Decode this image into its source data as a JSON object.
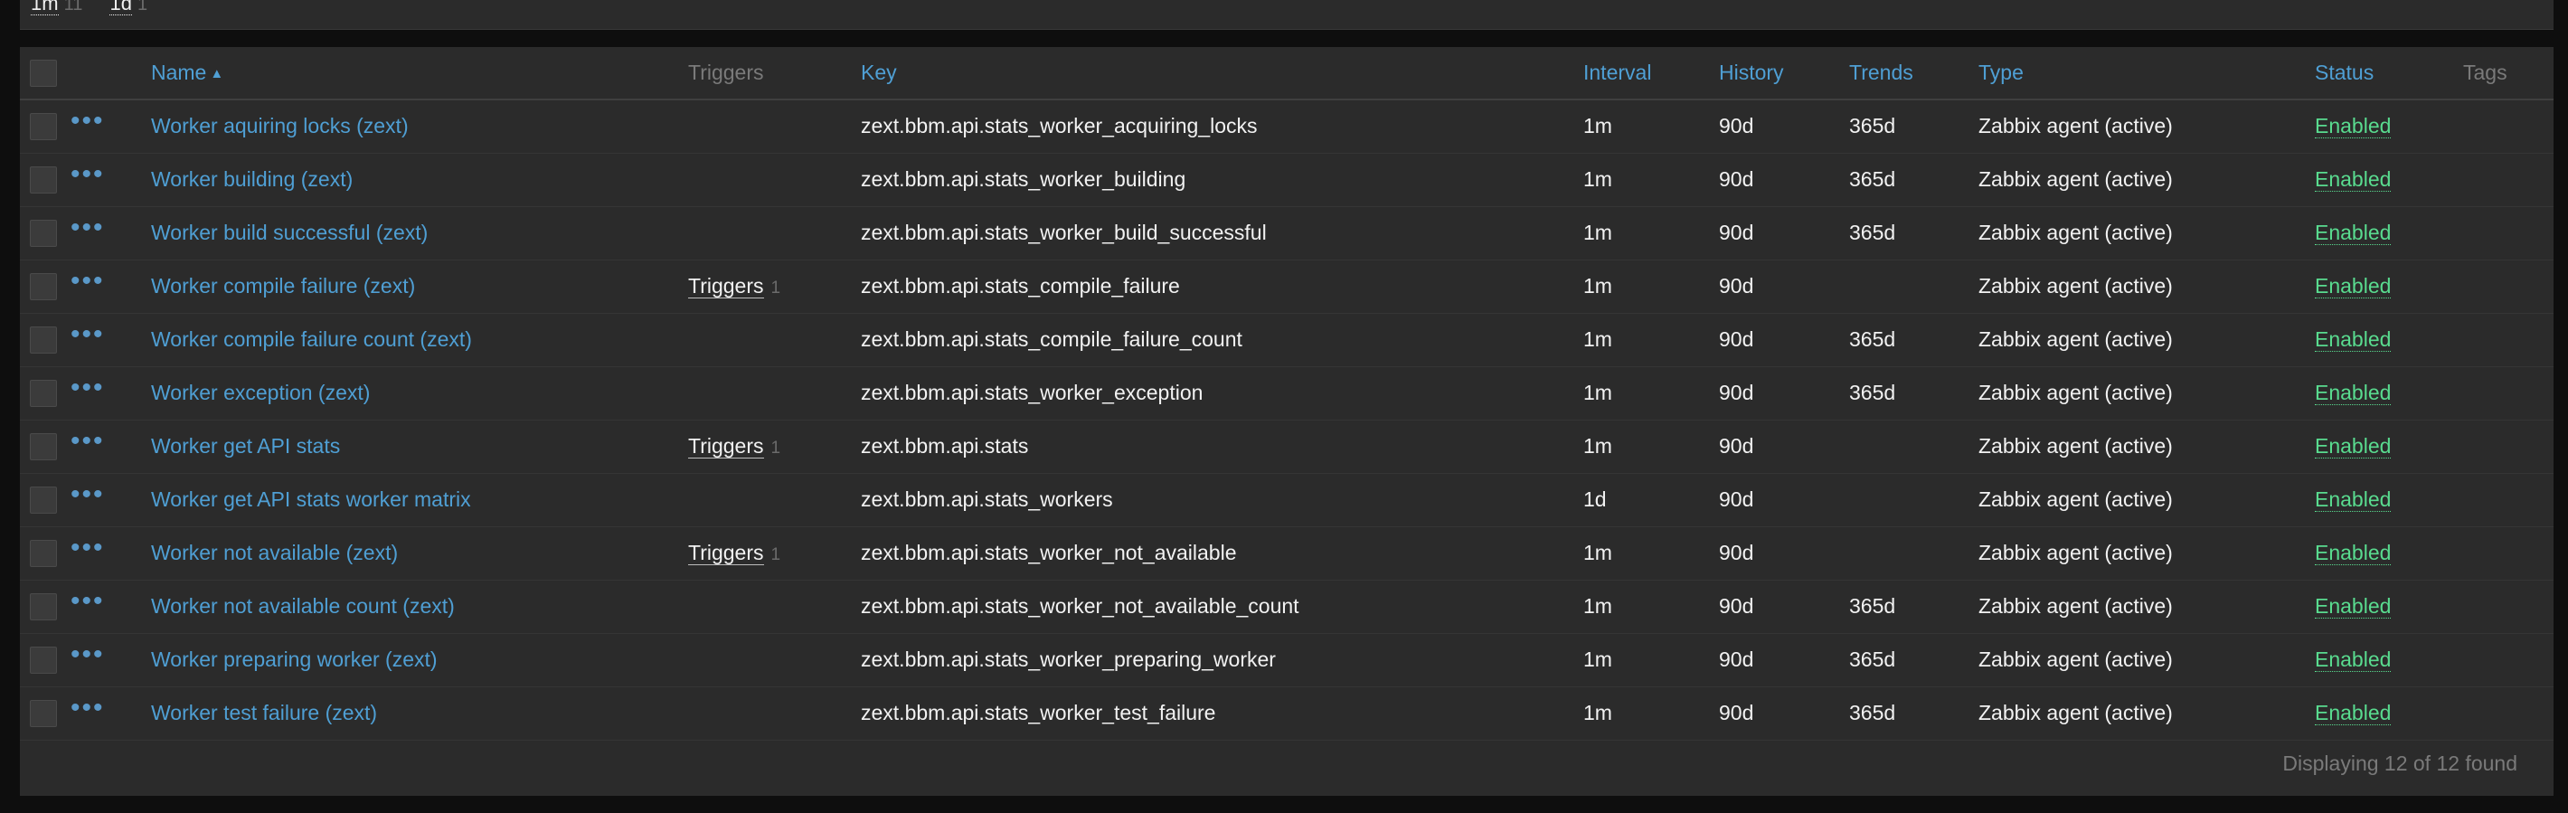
{
  "filter": {
    "tags": [
      {
        "label": "1m",
        "count": "11"
      },
      {
        "label": "1d",
        "count": "1"
      }
    ]
  },
  "table": {
    "headers": {
      "name": "Name",
      "name_sort_icon": "sort-ascending-icon",
      "triggers": "Triggers",
      "key": "Key",
      "interval": "Interval",
      "history": "History",
      "trends": "Trends",
      "type": "Type",
      "status": "Status",
      "tags": "Tags"
    },
    "actions_icon": "ellipsis-icon",
    "rows": [
      {
        "name": "Worker aquiring locks (zext)",
        "triggers": "",
        "triggers_count": "",
        "key": "zext.bbm.api.stats_worker_acquiring_locks",
        "interval": "1m",
        "history": "90d",
        "trends": "365d",
        "type": "Zabbix agent (active)",
        "status": "Enabled"
      },
      {
        "name": "Worker building (zext)",
        "triggers": "",
        "triggers_count": "",
        "key": "zext.bbm.api.stats_worker_building",
        "interval": "1m",
        "history": "90d",
        "trends": "365d",
        "type": "Zabbix agent (active)",
        "status": "Enabled"
      },
      {
        "name": "Worker build successful (zext)",
        "triggers": "",
        "triggers_count": "",
        "key": "zext.bbm.api.stats_worker_build_successful",
        "interval": "1m",
        "history": "90d",
        "trends": "365d",
        "type": "Zabbix agent (active)",
        "status": "Enabled"
      },
      {
        "name": "Worker compile failure (zext)",
        "triggers": "Triggers",
        "triggers_count": "1",
        "key": "zext.bbm.api.stats_compile_failure",
        "interval": "1m",
        "history": "90d",
        "trends": "",
        "type": "Zabbix agent (active)",
        "status": "Enabled"
      },
      {
        "name": "Worker compile failure count (zext)",
        "triggers": "",
        "triggers_count": "",
        "key": "zext.bbm.api.stats_compile_failure_count",
        "interval": "1m",
        "history": "90d",
        "trends": "365d",
        "type": "Zabbix agent (active)",
        "status": "Enabled"
      },
      {
        "name": "Worker exception (zext)",
        "triggers": "",
        "triggers_count": "",
        "key": "zext.bbm.api.stats_worker_exception",
        "interval": "1m",
        "history": "90d",
        "trends": "365d",
        "type": "Zabbix agent (active)",
        "status": "Enabled"
      },
      {
        "name": "Worker get API stats",
        "triggers": "Triggers",
        "triggers_count": "1",
        "key": "zext.bbm.api.stats",
        "interval": "1m",
        "history": "90d",
        "trends": "",
        "type": "Zabbix agent (active)",
        "status": "Enabled"
      },
      {
        "name": "Worker get API stats worker matrix",
        "triggers": "",
        "triggers_count": "",
        "key": "zext.bbm.api.stats_workers",
        "interval": "1d",
        "history": "90d",
        "trends": "",
        "type": "Zabbix agent (active)",
        "status": "Enabled"
      },
      {
        "name": "Worker not available (zext)",
        "triggers": "Triggers",
        "triggers_count": "1",
        "key": "zext.bbm.api.stats_worker_not_available",
        "interval": "1m",
        "history": "90d",
        "trends": "",
        "type": "Zabbix agent (active)",
        "status": "Enabled"
      },
      {
        "name": "Worker not available count (zext)",
        "triggers": "",
        "triggers_count": "",
        "key": "zext.bbm.api.stats_worker_not_available_count",
        "interval": "1m",
        "history": "90d",
        "trends": "365d",
        "type": "Zabbix agent (active)",
        "status": "Enabled"
      },
      {
        "name": "Worker preparing worker (zext)",
        "triggers": "",
        "triggers_count": "",
        "key": "zext.bbm.api.stats_worker_preparing_worker",
        "interval": "1m",
        "history": "90d",
        "trends": "365d",
        "type": "Zabbix agent (active)",
        "status": "Enabled"
      },
      {
        "name": "Worker test failure (zext)",
        "triggers": "",
        "triggers_count": "",
        "key": "zext.bbm.api.stats_worker_test_failure",
        "interval": "1m",
        "history": "90d",
        "trends": "365d",
        "type": "Zabbix agent (active)",
        "status": "Enabled"
      }
    ]
  },
  "footer": {
    "count_text": "Displaying 12 of 12 found"
  },
  "colors": {
    "link": "#4f9fd4",
    "enabled": "#59db8f",
    "panel": "#2b2b2b",
    "page_bg": "#0e0e0e"
  }
}
